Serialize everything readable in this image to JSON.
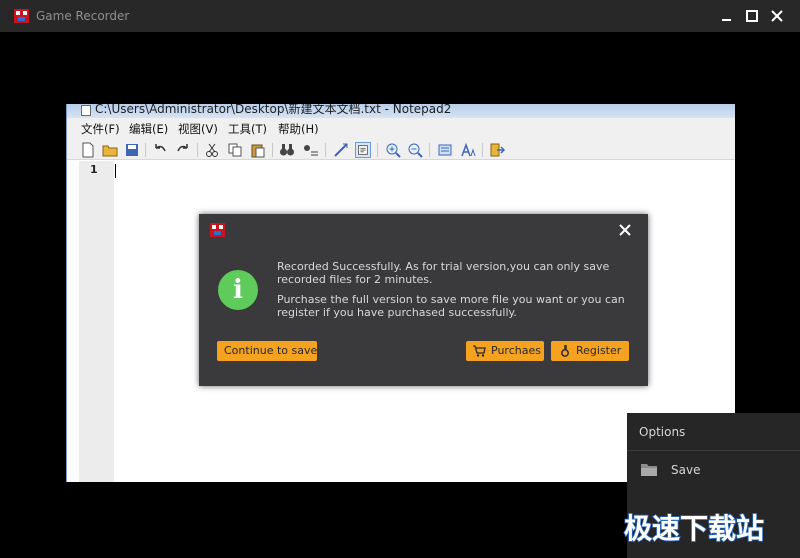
{
  "window": {
    "title": "Game Recorder"
  },
  "notepad": {
    "title": "C:\\Users\\Administrator\\Desktop\\新建文本文档.txt - Notepad2",
    "menu": [
      "文件(F)",
      "编辑(E)",
      "视图(V)",
      "工具(T)",
      "帮助(H)"
    ],
    "line_number": "1"
  },
  "dialog": {
    "message1": "Recorded Successfully. As for trial version,you can only save recorded files for 2 minutes.",
    "message2": "Purchase the full version to save more file you want or you can register if you have purchased successfully.",
    "continue_label": "Continue to save",
    "purchase_label": "Purchaes",
    "register_label": "Register"
  },
  "options": {
    "title": "Options",
    "save_label": "Save"
  },
  "watermark": {
    "text": "极速下载站"
  },
  "colors": {
    "accent": "#f4a21f",
    "success": "#5ecb5a",
    "dialog_bg": "#3a3a3c",
    "titlebar_bg": "#282828"
  }
}
